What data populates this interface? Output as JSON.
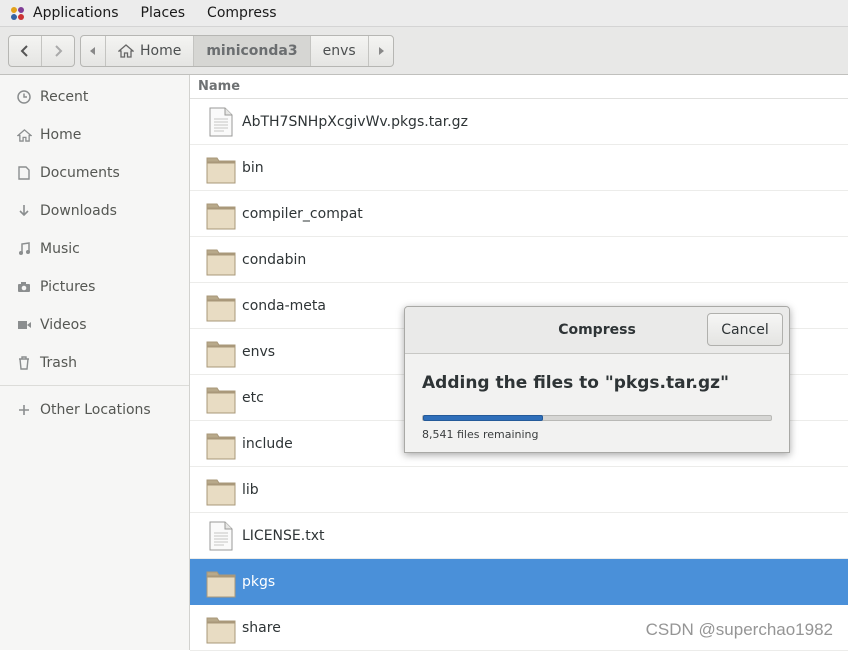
{
  "topbar": {
    "menus": [
      "Applications",
      "Places",
      "Compress"
    ]
  },
  "pathbar": {
    "items": [
      "Home",
      "miniconda3",
      "envs"
    ]
  },
  "sidebar": {
    "items": [
      "Recent",
      "Home",
      "Documents",
      "Downloads",
      "Music",
      "Pictures",
      "Videos",
      "Trash"
    ],
    "other": "Other Locations"
  },
  "list": {
    "header": "Name",
    "files": [
      {
        "name": "AbTH7SNHpXcgivWv.pkgs.tar.gz",
        "type": "file"
      },
      {
        "name": "bin",
        "type": "folder"
      },
      {
        "name": "compiler_compat",
        "type": "folder"
      },
      {
        "name": "condabin",
        "type": "folder"
      },
      {
        "name": "conda-meta",
        "type": "folder"
      },
      {
        "name": "envs",
        "type": "folder"
      },
      {
        "name": "etc",
        "type": "folder"
      },
      {
        "name": "include",
        "type": "folder"
      },
      {
        "name": "lib",
        "type": "folder"
      },
      {
        "name": "LICENSE.txt",
        "type": "file"
      },
      {
        "name": "pkgs",
        "type": "folder",
        "selected": true
      },
      {
        "name": "share",
        "type": "folder"
      }
    ]
  },
  "dialog": {
    "title": "Compress",
    "cancel": "Cancel",
    "message": "Adding the files to \"pkgs.tar.gz\"",
    "progress": 0.34,
    "status": "8,541 files remaining"
  },
  "watermark": "CSDN @superchao1982",
  "colors": {
    "selection": "#4a90d9",
    "progress": "#2f6fba"
  }
}
